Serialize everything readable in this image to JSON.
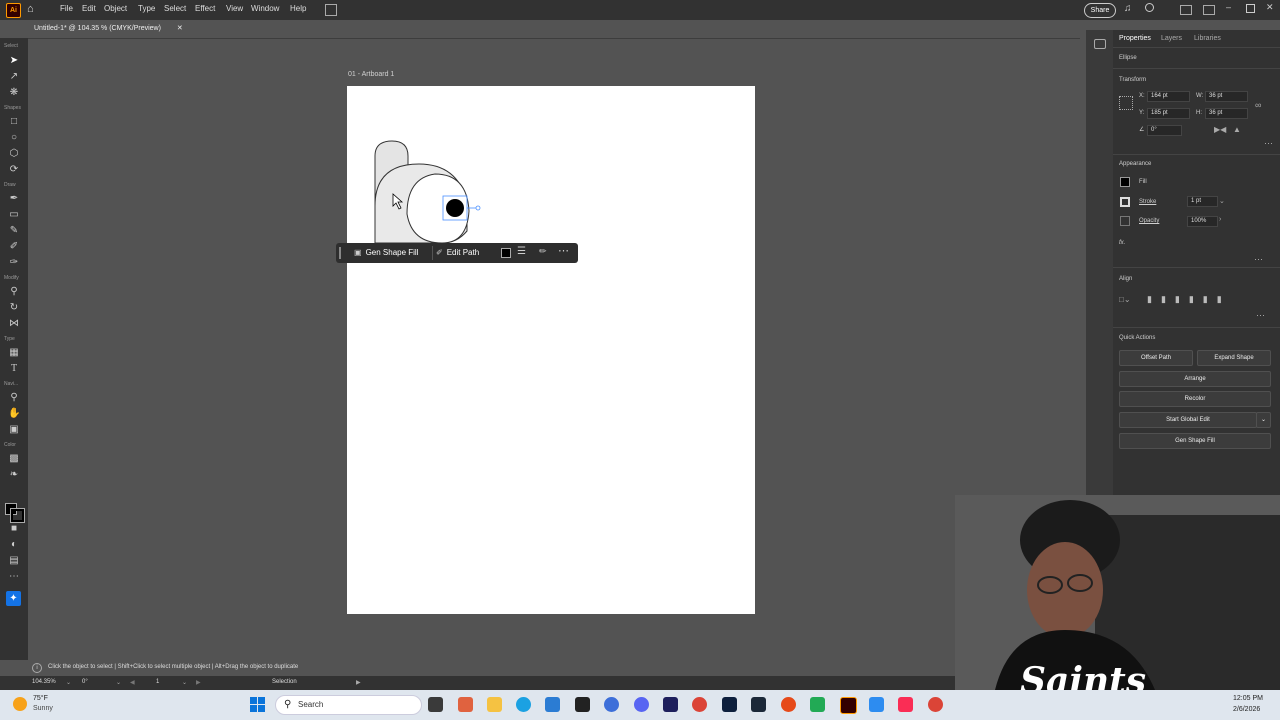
{
  "menubar": {
    "app_logo": "Ai",
    "items": [
      "File",
      "Edit",
      "Object",
      "Type",
      "Select",
      "Effect",
      "View",
      "Window",
      "Help"
    ],
    "share_label": "Share"
  },
  "document_tab": {
    "title": "Untitled-1* @ 104.35 % (CMYK/Preview)"
  },
  "toolbar": {
    "groups": [
      "Select",
      "Shapes",
      "Draw",
      "Modify",
      "Type",
      "Navi...",
      "Color"
    ]
  },
  "canvas": {
    "artboard_label": "01 - Artboard 1"
  },
  "context_bar": {
    "gen_shape_fill": "Gen Shape Fill",
    "edit_path": "Edit Path"
  },
  "panel": {
    "tabs": [
      "Properties",
      "Layers",
      "Libraries"
    ],
    "object_type": "Ellipse",
    "transform": {
      "header": "Transform",
      "x_label": "X:",
      "x_value": "164 pt",
      "y_label": "Y:",
      "y_value": "185 pt",
      "w_label": "W:",
      "w_value": "36 pt",
      "h_label": "H:",
      "h_value": "36 pt",
      "angle_value": "0°"
    },
    "appearance": {
      "header": "Appearance",
      "fill_label": "Fill",
      "stroke_label": "Stroke",
      "stroke_value": "1 pt",
      "opacity_label": "Opacity",
      "opacity_value": "100%",
      "fx_label": "fx."
    },
    "align": {
      "header": "Align"
    },
    "quick_actions": {
      "header": "Quick Actions",
      "offset_path": "Offset Path",
      "expand_shape": "Expand Shape",
      "arrange": "Arrange",
      "recolor": "Recolor",
      "start_global_edit": "Start Global Edit",
      "gen_shape_fill": "Gen Shape Fill"
    }
  },
  "status": {
    "hint": "Click the object to select  |  Shift+Click to select multiple object  |  Alt+Drag the object to duplicate",
    "zoom": "104.35%",
    "rotation": "0°",
    "artboard_num": "1",
    "tool_name": "Selection"
  },
  "taskbar": {
    "weather_temp": "75°F",
    "weather_desc": "Sunny",
    "search_placeholder": "Search",
    "time": "12:05 PM",
    "date": "2/6/2026"
  },
  "webcam": {
    "shirt_text": "Saints"
  },
  "colors": {
    "accent": "#1473e6",
    "selection_blue": "#4a90ff",
    "orange": "#ff9a00"
  }
}
